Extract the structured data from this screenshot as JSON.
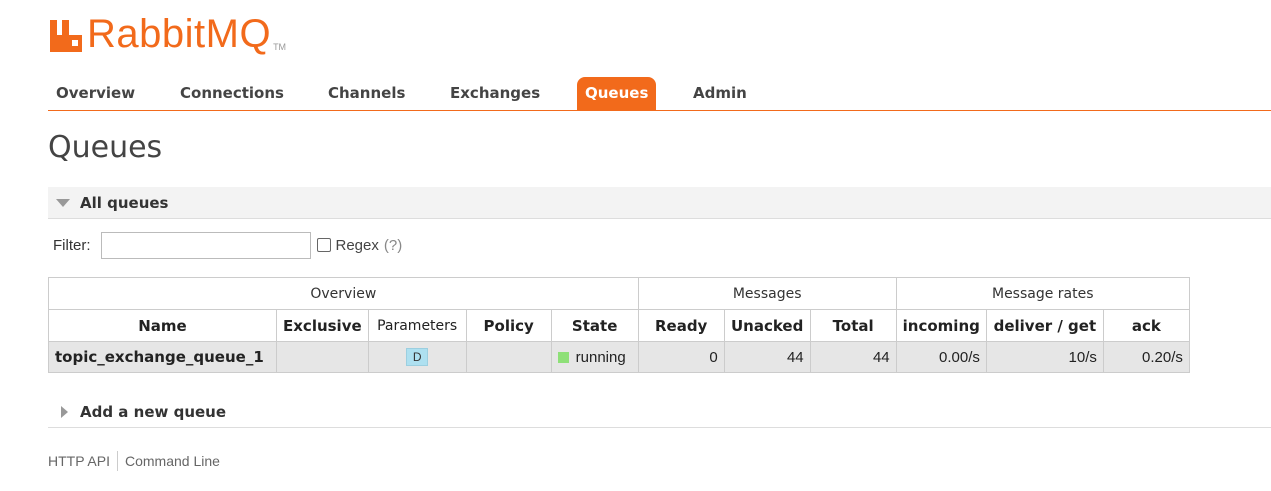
{
  "brand": {
    "word": "RabbitMQ",
    "tm": "TM",
    "accent": "#f26a1b"
  },
  "nav": {
    "tabs": [
      {
        "label": "Overview"
      },
      {
        "label": "Connections"
      },
      {
        "label": "Channels"
      },
      {
        "label": "Exchanges"
      },
      {
        "label": "Queues",
        "active": true
      },
      {
        "label": "Admin"
      }
    ]
  },
  "page": {
    "title": "Queues"
  },
  "all_queues": {
    "header": "All queues",
    "filter_label": "Filter:",
    "filter_value": "",
    "regex_label": "Regex",
    "regex_help": "(?)",
    "regex_checked": false
  },
  "table": {
    "groups": {
      "overview": "Overview",
      "messages": "Messages",
      "rates": "Message rates"
    },
    "columns": {
      "name": "Name",
      "exclusive": "Exclusive",
      "parameters": "Parameters",
      "policy": "Policy",
      "state": "State",
      "ready": "Ready",
      "unacked": "Unacked",
      "total": "Total",
      "incoming": "incoming",
      "deliver_get": "deliver / get",
      "ack": "ack"
    },
    "rows": [
      {
        "name": "topic_exchange_queue_1",
        "exclusive": "",
        "parameters": "D",
        "policy": "",
        "state": "running",
        "ready": "0",
        "unacked": "44",
        "total": "44",
        "incoming": "0.00/s",
        "deliver_get": "10/s",
        "ack": "0.20/s"
      }
    ]
  },
  "add_queue": {
    "header": "Add a new queue"
  },
  "footer": {
    "http_api": "HTTP API",
    "command_line": "Command Line"
  },
  "colors": {
    "state_running": "#8ee078",
    "param_badge": "#aee0f0"
  }
}
